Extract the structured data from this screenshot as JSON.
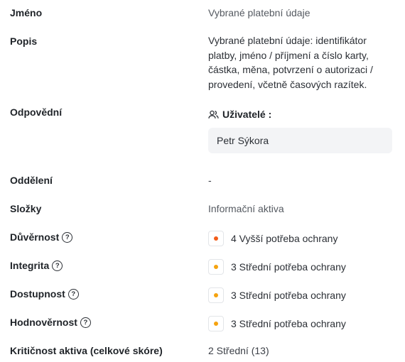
{
  "colors": {
    "high": "#f25c1a",
    "medium": "#f5a30f"
  },
  "fields": {
    "name": {
      "label": "Jméno",
      "value": "Vybrané platební údaje"
    },
    "description": {
      "label": "Popis",
      "value": "Vybrané platební údaje: identifikátor platby, jméno / příjmení a číslo karty, částka, měna, potvrzení o autorizaci / provedení, včetně časových razítek."
    },
    "responsible": {
      "label": "Odpovědní",
      "users_label": "Uživatelé :",
      "user": "Petr Sýkora"
    },
    "department": {
      "label": "Oddělení",
      "value": "-"
    },
    "folders": {
      "label": "Složky",
      "value": "Informační aktiva"
    },
    "confidentiality": {
      "label": "Důvěrnost",
      "value": "4 Vyšší potřeba ochrany",
      "level": "high"
    },
    "integrity": {
      "label": "Integrita",
      "value": "3 Střední potřeba ochrany",
      "level": "medium"
    },
    "availability": {
      "label": "Dostupnost",
      "value": "3 Střední potřeba ochrany",
      "level": "medium"
    },
    "authenticity": {
      "label": "Hodnověrnost",
      "value": "3 Střední potřeba ochrany",
      "level": "medium"
    },
    "criticality": {
      "label": "Kritičnost aktiva (celkové skóre)",
      "value": "2 Střední (13)"
    }
  },
  "icons": {
    "help": "help-circle-icon",
    "users": "users-icon"
  },
  "help_glyph": "?"
}
